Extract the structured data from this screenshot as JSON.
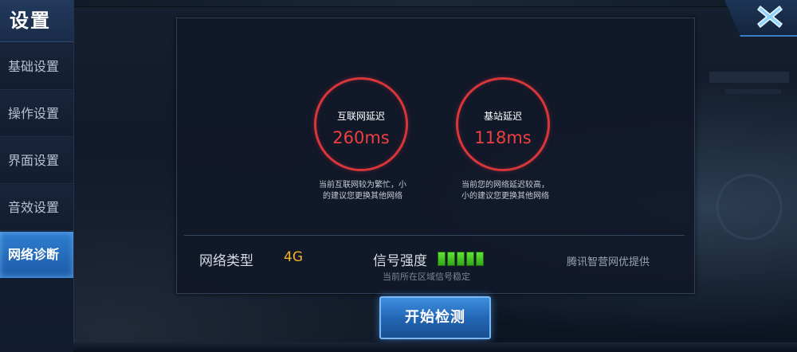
{
  "sidebar": {
    "title": "设置",
    "items": [
      {
        "label": "基础设置",
        "active": false
      },
      {
        "label": "操作设置",
        "active": false
      },
      {
        "label": "界面设置",
        "active": false
      },
      {
        "label": "音效设置",
        "active": false
      },
      {
        "label": "网络诊断",
        "active": true
      }
    ]
  },
  "close": {
    "icon": "close-x-icon"
  },
  "diagnostics": {
    "internet": {
      "label": "互联网延迟",
      "value": "260ms",
      "note_line1": "当前互联网较为繁忙，小",
      "note_line2": "的建议您更换其他网络"
    },
    "base_station": {
      "label": "基站延迟",
      "value": "118ms",
      "note_line1": "当前您的网络延迟较高，",
      "note_line2": "小的建议您更换其他网络"
    }
  },
  "network": {
    "type_label": "网络类型",
    "type_value": "4G",
    "signal_label": "信号强度",
    "signal_bars": 5,
    "signal_note": "当前所在区域信号稳定",
    "provider": "腾讯智营网优提供"
  },
  "start_button": "开始检测",
  "colors": {
    "accent_blue": "#2f7fd0",
    "ring_red": "#d9363b",
    "value_red": "#ef3f3f",
    "network_type_gold": "#f3b02a",
    "signal_green": "#4fd22c"
  }
}
